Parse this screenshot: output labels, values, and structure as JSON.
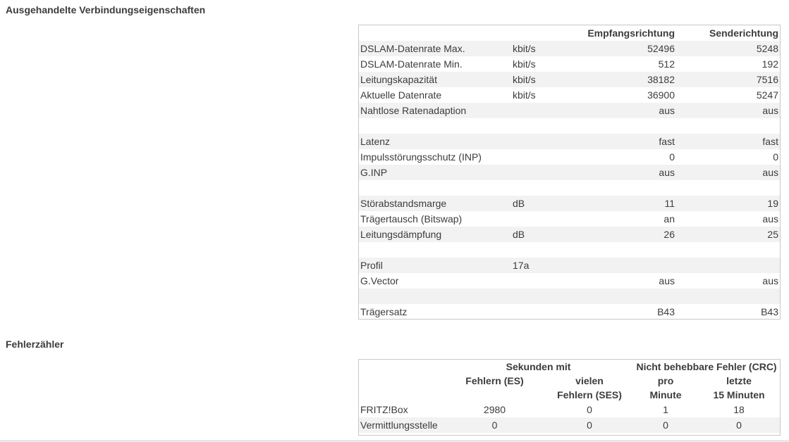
{
  "section_connection": {
    "title": "Ausgehandelte Verbindungseigenschaften",
    "header": {
      "label": "",
      "unit": "",
      "downstream": "Empfangsrichtung",
      "upstream": "Senderichtung"
    },
    "rows": [
      {
        "label": "DSLAM-Datenrate Max.",
        "unit": "kbit/s",
        "down": "52496",
        "up": "5248"
      },
      {
        "label": "DSLAM-Datenrate Min.",
        "unit": "kbit/s",
        "down": "512",
        "up": "192"
      },
      {
        "label": "Leitungskapazität",
        "unit": "kbit/s",
        "down": "38182",
        "up": "7516"
      },
      {
        "label": "Aktuelle Datenrate",
        "unit": "kbit/s",
        "down": "36900",
        "up": "5247"
      },
      {
        "label": "Nahtlose Ratenadaption",
        "unit": "",
        "down": "aus",
        "up": "aus"
      },
      {
        "label": "",
        "unit": "",
        "down": "",
        "up": ""
      },
      {
        "label": "Latenz",
        "unit": "",
        "down": "fast",
        "up": "fast"
      },
      {
        "label": "Impulsstörungsschutz (INP)",
        "unit": "",
        "down": "0",
        "up": "0"
      },
      {
        "label": "G.INP",
        "unit": "",
        "down": "aus",
        "up": "aus"
      },
      {
        "label": "",
        "unit": "",
        "down": "",
        "up": ""
      },
      {
        "label": "Störabstandsmarge",
        "unit": "dB",
        "down": "11",
        "up": "19"
      },
      {
        "label": "Trägertausch (Bitswap)",
        "unit": "",
        "down": "an",
        "up": "aus"
      },
      {
        "label": "Leitungsdämpfung",
        "unit": "dB",
        "down": "26",
        "up": "25"
      },
      {
        "label": "",
        "unit": "",
        "down": "",
        "up": ""
      },
      {
        "label": "Profil",
        "unit": "17a",
        "down": "",
        "up": ""
      },
      {
        "label": "G.Vector",
        "unit": "",
        "down": "aus",
        "up": "aus"
      },
      {
        "label": "",
        "unit": "",
        "down": "",
        "up": ""
      },
      {
        "label": "Trägersatz",
        "unit": "",
        "down": "B43",
        "up": "B43"
      }
    ]
  },
  "section_errors": {
    "title": "Fehlerzähler",
    "header": {
      "group_seconds": "Sekunden mit",
      "group_crc": "Nicht behebbare Fehler (CRC)",
      "es": "Fehlern (ES)",
      "ses_line1": "vielen",
      "ses_line2": "Fehlern (SES)",
      "crc_min_line1": "pro",
      "crc_min_line2": "Minute",
      "crc_15_line1": "letzte",
      "crc_15_line2": "15 Minuten"
    },
    "rows": [
      {
        "label": "FRITZ!Box",
        "es": "2980",
        "ses": "0",
        "crc_min": "1",
        "crc_15": "18"
      },
      {
        "label": "Vermittlungsstelle",
        "es": "0",
        "ses": "0",
        "crc_min": "0",
        "crc_15": "0"
      }
    ]
  }
}
